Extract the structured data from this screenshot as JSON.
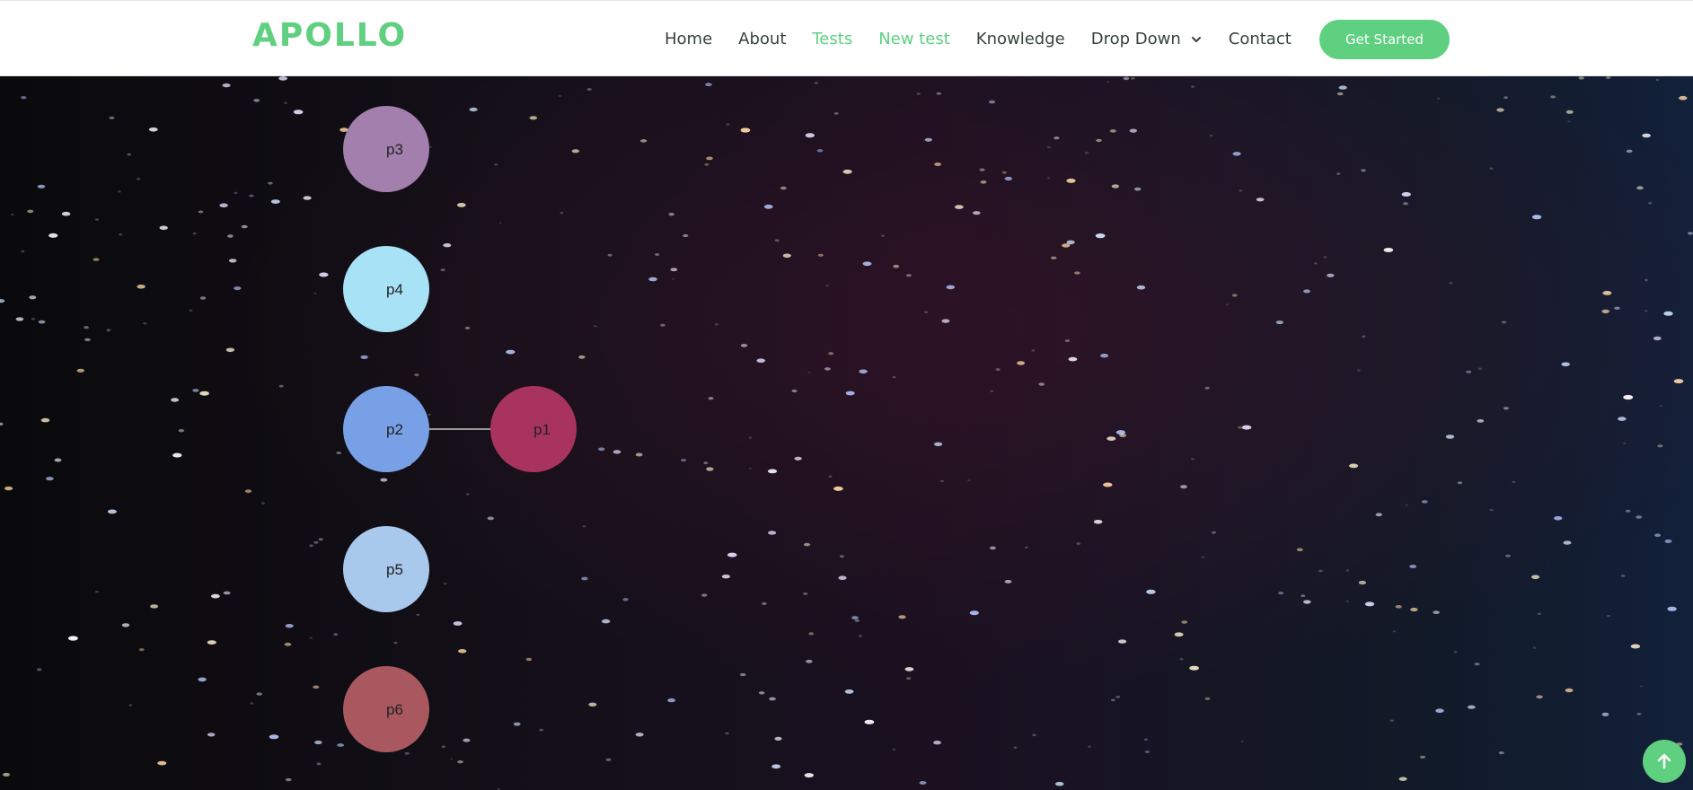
{
  "header": {
    "logo": "APOLLO",
    "nav": [
      {
        "label": "Home",
        "active": false
      },
      {
        "label": "About",
        "active": false
      },
      {
        "label": "Tests",
        "active": true
      },
      {
        "label": "New test",
        "active": true
      },
      {
        "label": "Knowledge",
        "active": false
      },
      {
        "label": "Drop Down",
        "active": false,
        "dropdown": true
      },
      {
        "label": "Contact",
        "active": false
      }
    ],
    "cta": "Get Started"
  },
  "colors": {
    "accent": "#5fcf80",
    "nav_text": "#37423b"
  },
  "graph": {
    "nodes": [
      {
        "id": "p3",
        "label": "p3",
        "color": "#a27fad"
      },
      {
        "id": "p4",
        "label": "p4",
        "color": "#a8e2f7"
      },
      {
        "id": "p2",
        "label": "p2",
        "color": "#77a0e6"
      },
      {
        "id": "p1",
        "label": "p1",
        "color": "#a8345e"
      },
      {
        "id": "p5",
        "label": "p5",
        "color": "#a8c8ec"
      },
      {
        "id": "p6",
        "label": "p6",
        "color": "#a9585f"
      }
    ],
    "edges": [
      {
        "source": "p2",
        "target": "p1"
      }
    ]
  },
  "scroll_top_icon": "arrow-up-icon"
}
